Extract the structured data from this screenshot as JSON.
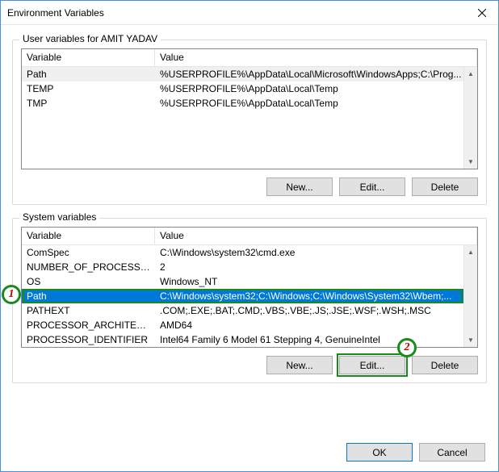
{
  "window": {
    "title": "Environment Variables"
  },
  "userVars": {
    "legend": "User variables for AMIT YADAV",
    "headers": {
      "variable": "Variable",
      "value": "Value"
    },
    "rows": [
      {
        "variable": "Path",
        "value": "%USERPROFILE%\\AppData\\Local\\Microsoft\\WindowsApps;C:\\Prog..."
      },
      {
        "variable": "TEMP",
        "value": "%USERPROFILE%\\AppData\\Local\\Temp"
      },
      {
        "variable": "TMP",
        "value": "%USERPROFILE%\\AppData\\Local\\Temp"
      }
    ],
    "selectedIndex": 0,
    "buttons": {
      "new": "New...",
      "edit": "Edit...",
      "delete": "Delete"
    }
  },
  "systemVars": {
    "legend": "System variables",
    "headers": {
      "variable": "Variable",
      "value": "Value"
    },
    "rows": [
      {
        "variable": "ComSpec",
        "value": "C:\\Windows\\system32\\cmd.exe"
      },
      {
        "variable": "NUMBER_OF_PROCESSORS",
        "value": "2"
      },
      {
        "variable": "OS",
        "value": "Windows_NT"
      },
      {
        "variable": "Path",
        "value": "C:\\Windows\\system32;C:\\Windows;C:\\Windows\\System32\\Wbem;..."
      },
      {
        "variable": "PATHEXT",
        "value": ".COM;.EXE;.BAT;.CMD;.VBS;.VBE;.JS;.JSE;.WSF;.WSH;.MSC"
      },
      {
        "variable": "PROCESSOR_ARCHITECTURE",
        "value": "AMD64"
      },
      {
        "variable": "PROCESSOR_IDENTIFIER",
        "value": "Intel64 Family 6 Model 61 Stepping 4, GenuineIntel"
      }
    ],
    "selectedIndex": 3,
    "buttons": {
      "new": "New...",
      "edit": "Edit...",
      "delete": "Delete"
    }
  },
  "dialogButtons": {
    "ok": "OK",
    "cancel": "Cancel"
  },
  "annotations": {
    "marker1": "1",
    "marker2": "2"
  }
}
